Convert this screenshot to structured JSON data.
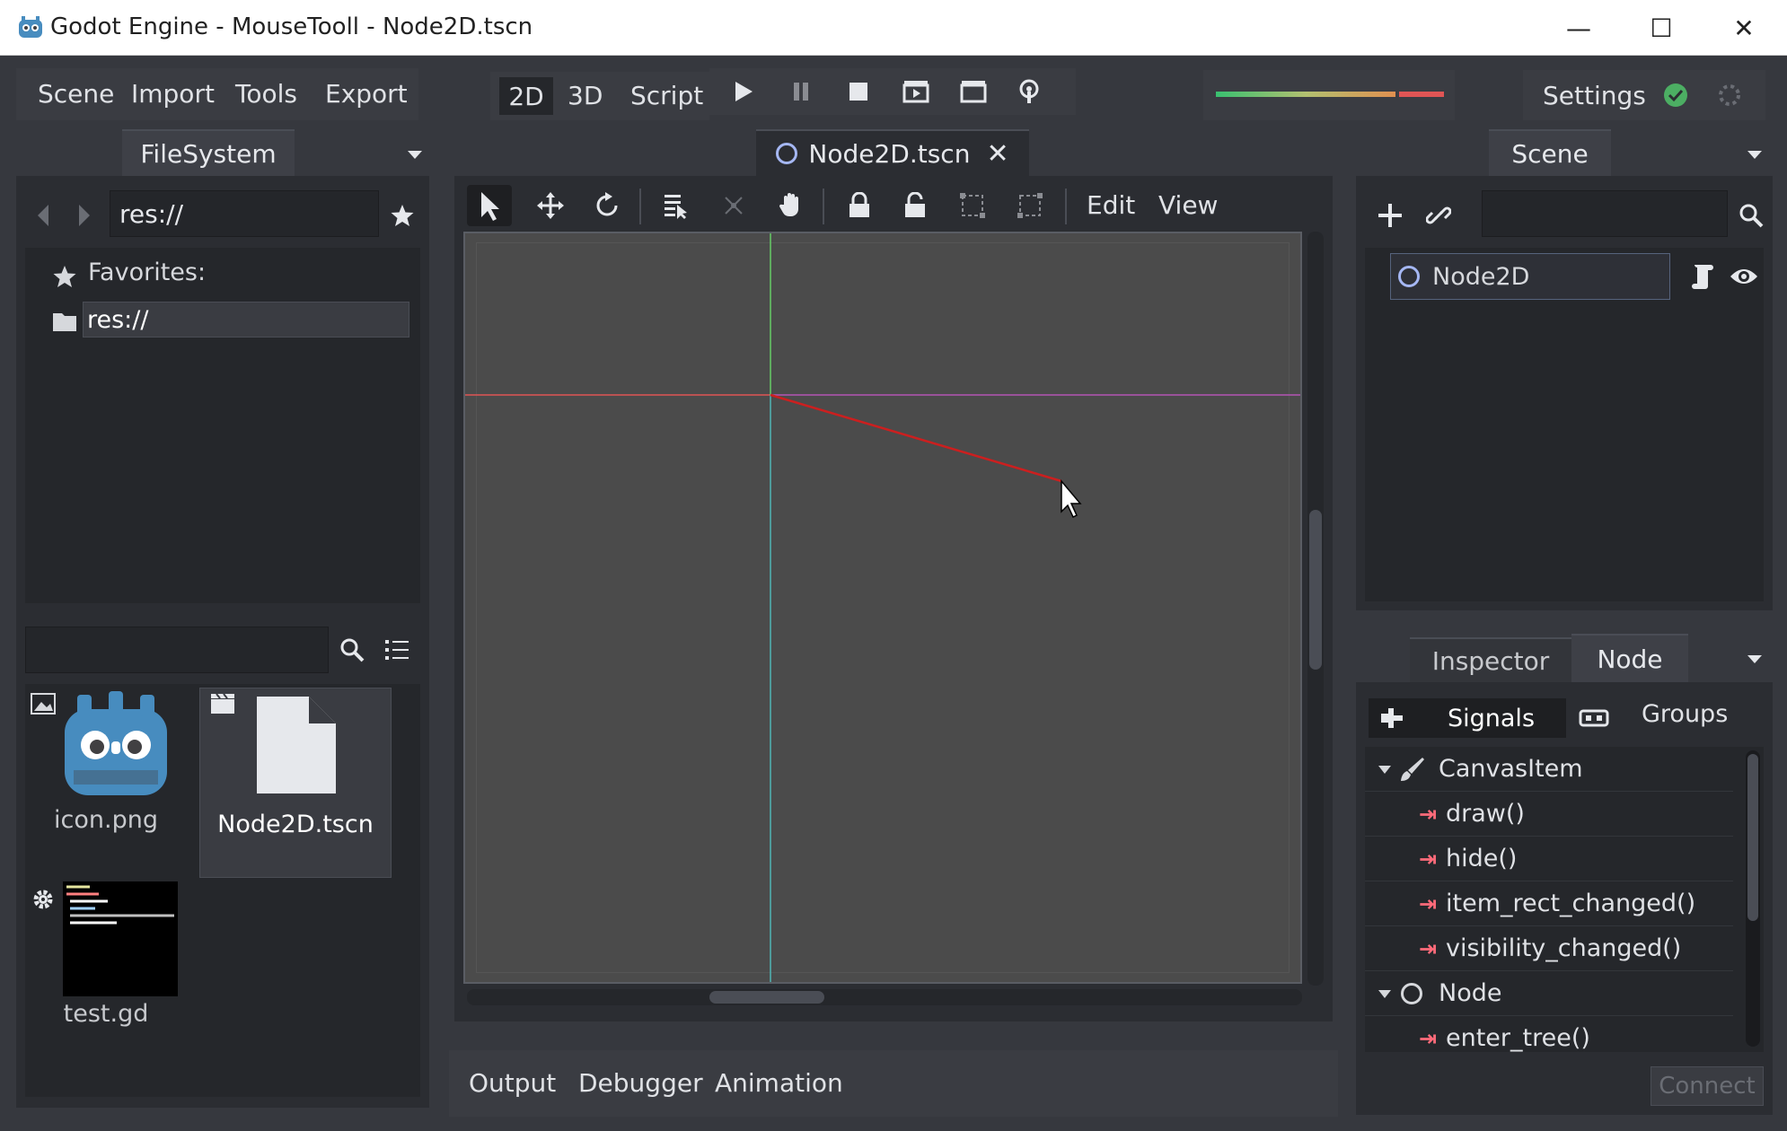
{
  "window": {
    "title": "Godot Engine - MouseTooll - Node2D.tscn",
    "minimize_glyph": "—",
    "maximize_glyph": "☐",
    "close_glyph": "✕"
  },
  "menu": {
    "items": [
      "Scene",
      "Import",
      "Tools",
      "Export"
    ]
  },
  "modes": {
    "items": [
      "2D",
      "3D",
      "Script"
    ],
    "active": "2D"
  },
  "settings": {
    "label": "Settings"
  },
  "filesystem": {
    "tab": "FileSystem",
    "path": "res://",
    "favorites_label": "Favorites:",
    "tree_item": "res://",
    "files": [
      {
        "name": "icon.png",
        "type": "image"
      },
      {
        "name": "Node2D.tscn",
        "type": "scene"
      },
      {
        "name": "test.gd",
        "type": "script"
      }
    ]
  },
  "editor": {
    "tab": "Node2D.tscn",
    "toolbar_menus": [
      "Edit",
      "View"
    ]
  },
  "bottom": {
    "tabs": [
      "Output",
      "Debugger",
      "Animation"
    ]
  },
  "scene": {
    "tab": "Scene",
    "root_node": "Node2D"
  },
  "dock": {
    "tabs": [
      "Inspector",
      "Node"
    ],
    "active": "Node",
    "subtabs": [
      "Signals",
      "Groups"
    ],
    "signals": [
      {
        "kind": "category",
        "label": "CanvasItem"
      },
      {
        "kind": "signal",
        "label": "draw()"
      },
      {
        "kind": "signal",
        "label": "hide()"
      },
      {
        "kind": "signal",
        "label": "item_rect_changed()"
      },
      {
        "kind": "signal",
        "label": "visibility_changed()"
      },
      {
        "kind": "category",
        "label": "Node"
      },
      {
        "kind": "signal",
        "label": "enter_tree()"
      }
    ],
    "connect_label": "Connect"
  },
  "colors": {
    "background": "#36383e",
    "panel": "#2b2d32",
    "viewport": "#4b4b4b",
    "axis_x": "#e05555",
    "axis_y": "#66cc66",
    "signal": "#ff6b7a"
  }
}
